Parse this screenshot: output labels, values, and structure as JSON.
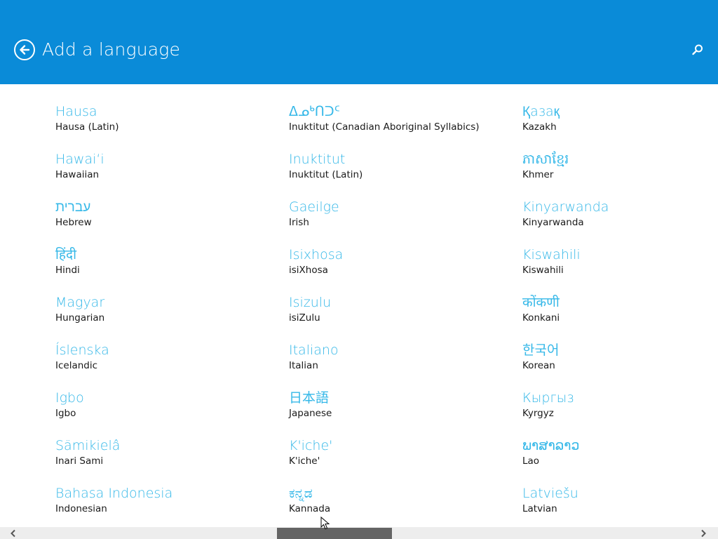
{
  "header": {
    "title": "Add a language",
    "back_icon": "back-arrow-circle-icon",
    "search_icon": "search-icon",
    "background_color": "#0a8bd8"
  },
  "languages": [
    [
      {
        "native": "Hausa",
        "english": "Hausa (Latin)"
      },
      {
        "native": "Hawaiʻi",
        "english": "Hawaiian"
      },
      {
        "native": "עברית",
        "english": "Hebrew"
      },
      {
        "native": "हिंदी",
        "english": "Hindi"
      },
      {
        "native": "Magyar",
        "english": "Hungarian"
      },
      {
        "native": "Íslenska",
        "english": "Icelandic"
      },
      {
        "native": "Igbo",
        "english": "Igbo"
      },
      {
        "native": "Sämikielâ",
        "english": "Inari Sami"
      },
      {
        "native": "Bahasa Indonesia",
        "english": "Indonesian"
      }
    ],
    [
      {
        "native": "ᐃᓄᒃᑎᑐᑦ",
        "english": "Inuktitut (Canadian Aboriginal Syllabics)"
      },
      {
        "native": "Inuktitut",
        "english": "Inuktitut (Latin)"
      },
      {
        "native": "Gaeilge",
        "english": "Irish"
      },
      {
        "native": "Isixhosa",
        "english": "isiXhosa"
      },
      {
        "native": "Isizulu",
        "english": "isiZulu"
      },
      {
        "native": "Italiano",
        "english": "Italian"
      },
      {
        "native": "日本語",
        "english": "Japanese"
      },
      {
        "native": "K'iche'",
        "english": "K'iche'"
      },
      {
        "native": "ಕನ್ನಡ",
        "english": "Kannada"
      }
    ],
    [
      {
        "native": "Қазақ",
        "english": "Kazakh"
      },
      {
        "native": "ភាសាខ្មែរ",
        "english": "Khmer"
      },
      {
        "native": "Kinyarwanda",
        "english": "Kinyarwanda"
      },
      {
        "native": "Kiswahili",
        "english": "Kiswahili"
      },
      {
        "native": "कोंकणी",
        "english": "Konkani"
      },
      {
        "native": "한국어",
        "english": "Korean"
      },
      {
        "native": "Кыргыз",
        "english": "Kyrgyz"
      },
      {
        "native": "ພາສາລາວ",
        "english": "Lao"
      },
      {
        "native": "Latviešu",
        "english": "Latvian"
      }
    ]
  ],
  "scrollbar": {
    "left_icon": "chevron-left-icon",
    "right_icon": "chevron-right-icon",
    "thumb_color": "#646464"
  },
  "colors": {
    "accent": "#36b8e8",
    "text": "#1a1a1a"
  }
}
